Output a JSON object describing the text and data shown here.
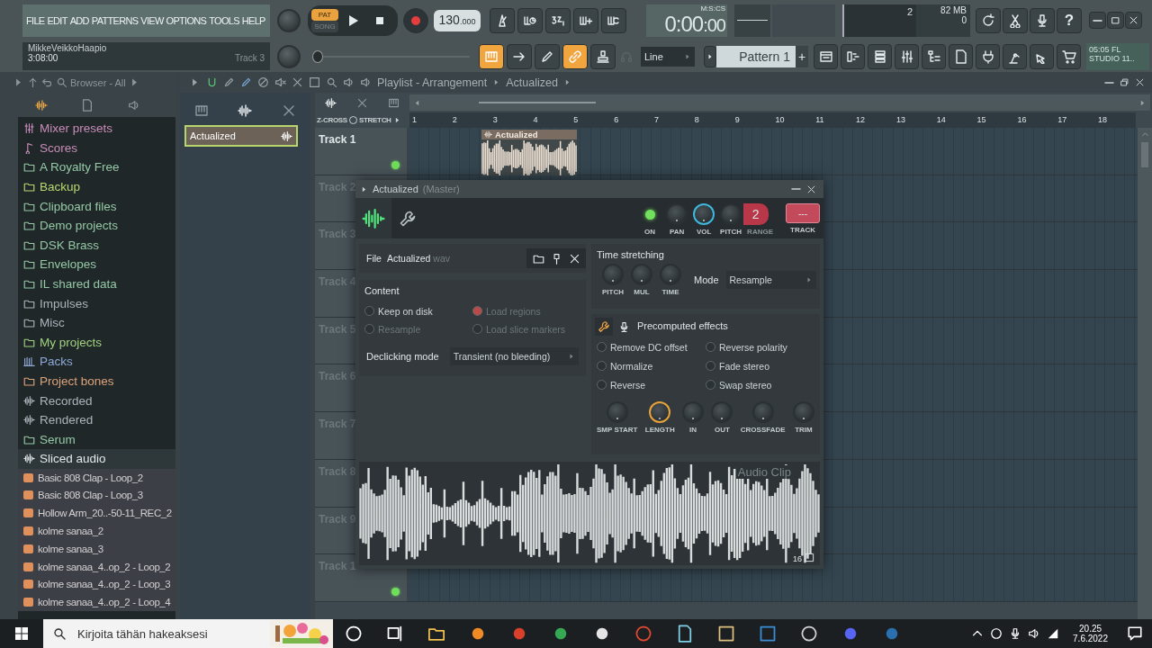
{
  "menu": [
    "FILE",
    "EDIT",
    "ADD",
    "PATTERNS",
    "VIEW",
    "OPTIONS",
    "TOOLS",
    "HELP"
  ],
  "transport": {
    "pat_song": [
      {
        "label": "PAT",
        "selected": true
      },
      {
        "label": "SONG",
        "selected": false
      }
    ],
    "tempo": "130",
    "tempo_decimals": ".000"
  },
  "time": {
    "value": "0:00",
    "sub": ":00",
    "unit": "M:S:CS"
  },
  "hint": {
    "title": "MikkeVeikkoHaapio",
    "time": "3:08:00",
    "track": "Track 3"
  },
  "monitor": {
    "cpu": "2",
    "memory": "82 MB",
    "polyphony": "0"
  },
  "tools_top": [
    {
      "kind": "metronome",
      "on": false
    },
    {
      "kind": "waitrec",
      "on": false
    },
    {
      "kind": "countdown",
      "on": false
    },
    {
      "kind": "step",
      "on": false
    },
    {
      "kind": "loop",
      "on": false
    }
  ],
  "tools_bottom": [
    {
      "kind": "keyboard",
      "on": true
    },
    {
      "kind": "arrow",
      "on": false
    },
    {
      "kind": "pen",
      "on": false
    },
    {
      "kind": "link",
      "on": true
    },
    {
      "kind": "stamp",
      "on": false
    }
  ],
  "help_label": "?",
  "snap": "Line",
  "pattern": "Pattern 1",
  "add_label": "+",
  "song_position": {
    "level": 0
  },
  "news": {
    "line1": "05:05  FL",
    "line2": "STUDIO 11.."
  },
  "browser": {
    "title": "Browser - All",
    "items": [
      {
        "label": "Mixer presets",
        "kind": "mixer",
        "color": "#c98cb8"
      },
      {
        "label": "Scores",
        "kind": "note",
        "color": "#c98cb8"
      },
      {
        "label": "A Royalty Free",
        "kind": "folder",
        "color": "#95c9a6"
      },
      {
        "label": "Backup",
        "kind": "folder",
        "color": "#b9d870"
      },
      {
        "label": "Clipboard files",
        "kind": "folder",
        "color": "#95c9a6"
      },
      {
        "label": "Demo projects",
        "kind": "folder",
        "color": "#95c9a6"
      },
      {
        "label": "DSK Brass",
        "kind": "folder",
        "color": "#95c9a6"
      },
      {
        "label": "Envelopes",
        "kind": "folder",
        "color": "#95c9a6"
      },
      {
        "label": "IL shared data",
        "kind": "folder",
        "color": "#95c9a6"
      },
      {
        "label": "Impulses",
        "kind": "folder",
        "color": "#aab5ba"
      },
      {
        "label": "Misc",
        "kind": "folder",
        "color": "#aab5ba"
      },
      {
        "label": "My projects",
        "kind": "folder",
        "color": "#a2d27e"
      },
      {
        "label": "Packs",
        "kind": "packs",
        "color": "#8ea8d8"
      },
      {
        "label": "Project bones",
        "kind": "folder",
        "color": "#dca27a"
      },
      {
        "label": "Recorded",
        "kind": "wave",
        "color": "#aab5ba"
      },
      {
        "label": "Rendered",
        "kind": "wave",
        "color": "#aab5ba"
      },
      {
        "label": "Serum",
        "kind": "folder",
        "color": "#95c9a6"
      },
      {
        "label": "Sliced audio",
        "kind": "wave",
        "color": "#e2e8ea",
        "expanded": true,
        "children": [
          {
            "label": "Basic 808 Clap - Loop_2"
          },
          {
            "label": "Basic 808 Clap - Loop_3"
          },
          {
            "label": "Hollow Arm_20..-50-11_REC_2"
          },
          {
            "label": "kolme sanaa_2"
          },
          {
            "label": "kolme sanaa_3"
          },
          {
            "label": "kolme sanaa_4..op_2 - Loop_2"
          },
          {
            "label": "kolme sanaa_4..op_2 - Loop_3"
          },
          {
            "label": "kolme sanaa_4..op_2 - Loop_4"
          }
        ]
      }
    ]
  },
  "picker": {
    "items": [
      {
        "label": "Actualized",
        "selected": true
      }
    ]
  },
  "playlist": {
    "title": "Playlist - Arrangement",
    "breadcrumb": "Actualized",
    "zcross": "Z-CROSS",
    "stretch": "STRETCH",
    "ruler": [
      "1",
      "2",
      "3",
      "4",
      "5",
      "6",
      "7",
      "8",
      "9",
      "10",
      "11",
      "12",
      "13",
      "14",
      "15",
      "16",
      "17",
      "18"
    ],
    "tracks": [
      {
        "name": "Track 1",
        "on": true,
        "clips": [
          {
            "name": "Actualized"
          }
        ]
      },
      {
        "name": "Track 2"
      },
      {
        "name": "Track 3"
      },
      {
        "name": "Track 4"
      },
      {
        "name": "Track 5"
      },
      {
        "name": "Track 6"
      },
      {
        "name": "Track 7"
      },
      {
        "name": "Track 8"
      },
      {
        "name": "Track 9"
      },
      {
        "name": "Track 1",
        "on": true
      }
    ]
  },
  "dialog": {
    "title": "Actualized",
    "subtitle": "(Master)",
    "on": true,
    "on_label": "ON",
    "knobs": [
      {
        "label": "PAN",
        "highlighted": false
      },
      {
        "label": "VOL",
        "highlighted": true
      },
      {
        "label": "PITCH",
        "highlighted": false
      }
    ],
    "range": {
      "value": "2",
      "label": "RANGE"
    },
    "track": {
      "value": "---",
      "label": "TRACK"
    },
    "file": {
      "label": "File",
      "name": "Actualized",
      "ext": "wav"
    },
    "content": {
      "title": "Content",
      "options": [
        {
          "label": "Keep on disk",
          "checked": false,
          "disabled": false
        },
        {
          "label": "Load regions",
          "checked": true,
          "disabled": true
        },
        {
          "label": "Resample",
          "checked": false,
          "disabled": true
        },
        {
          "label": "Load slice markers",
          "checked": false,
          "disabled": true
        }
      ]
    },
    "declicking": {
      "label": "Declicking mode",
      "value": "Transient (no bleeding)"
    },
    "time_stretching": {
      "title": "Time stretching",
      "knobs": [
        {
          "label": "PITCH",
          "highlighted": false
        },
        {
          "label": "MUL",
          "highlighted": false
        },
        {
          "label": "TIME",
          "highlighted": false
        }
      ],
      "mode_label": "Mode",
      "mode": "Resample"
    },
    "effects": {
      "title": "Precomputed effects",
      "options": [
        {
          "label": "Remove DC offset",
          "checked": false
        },
        {
          "label": "Reverse polarity",
          "checked": false
        },
        {
          "label": "Normalize",
          "checked": false
        },
        {
          "label": "Fade stereo",
          "checked": false
        },
        {
          "label": "Reverse",
          "checked": false
        },
        {
          "label": "Swap stereo",
          "checked": false
        }
      ],
      "knobs": [
        {
          "label": "SMP START",
          "highlighted": false
        },
        {
          "label": "LENGTH",
          "highlighted": true
        },
        {
          "label": "IN",
          "highlighted": false
        },
        {
          "label": "OUT",
          "highlighted": false
        },
        {
          "label": "CROSSFADE",
          "highlighted": false
        },
        {
          "label": "TRIM",
          "highlighted": false
        }
      ]
    },
    "waveform": {
      "label": "Audio Clip",
      "zoom": "16"
    }
  },
  "taskbar": {
    "search_placeholder": "Kirjoita tähän hakeaksesi",
    "time": "20.25",
    "date": "7.6.2022"
  }
}
